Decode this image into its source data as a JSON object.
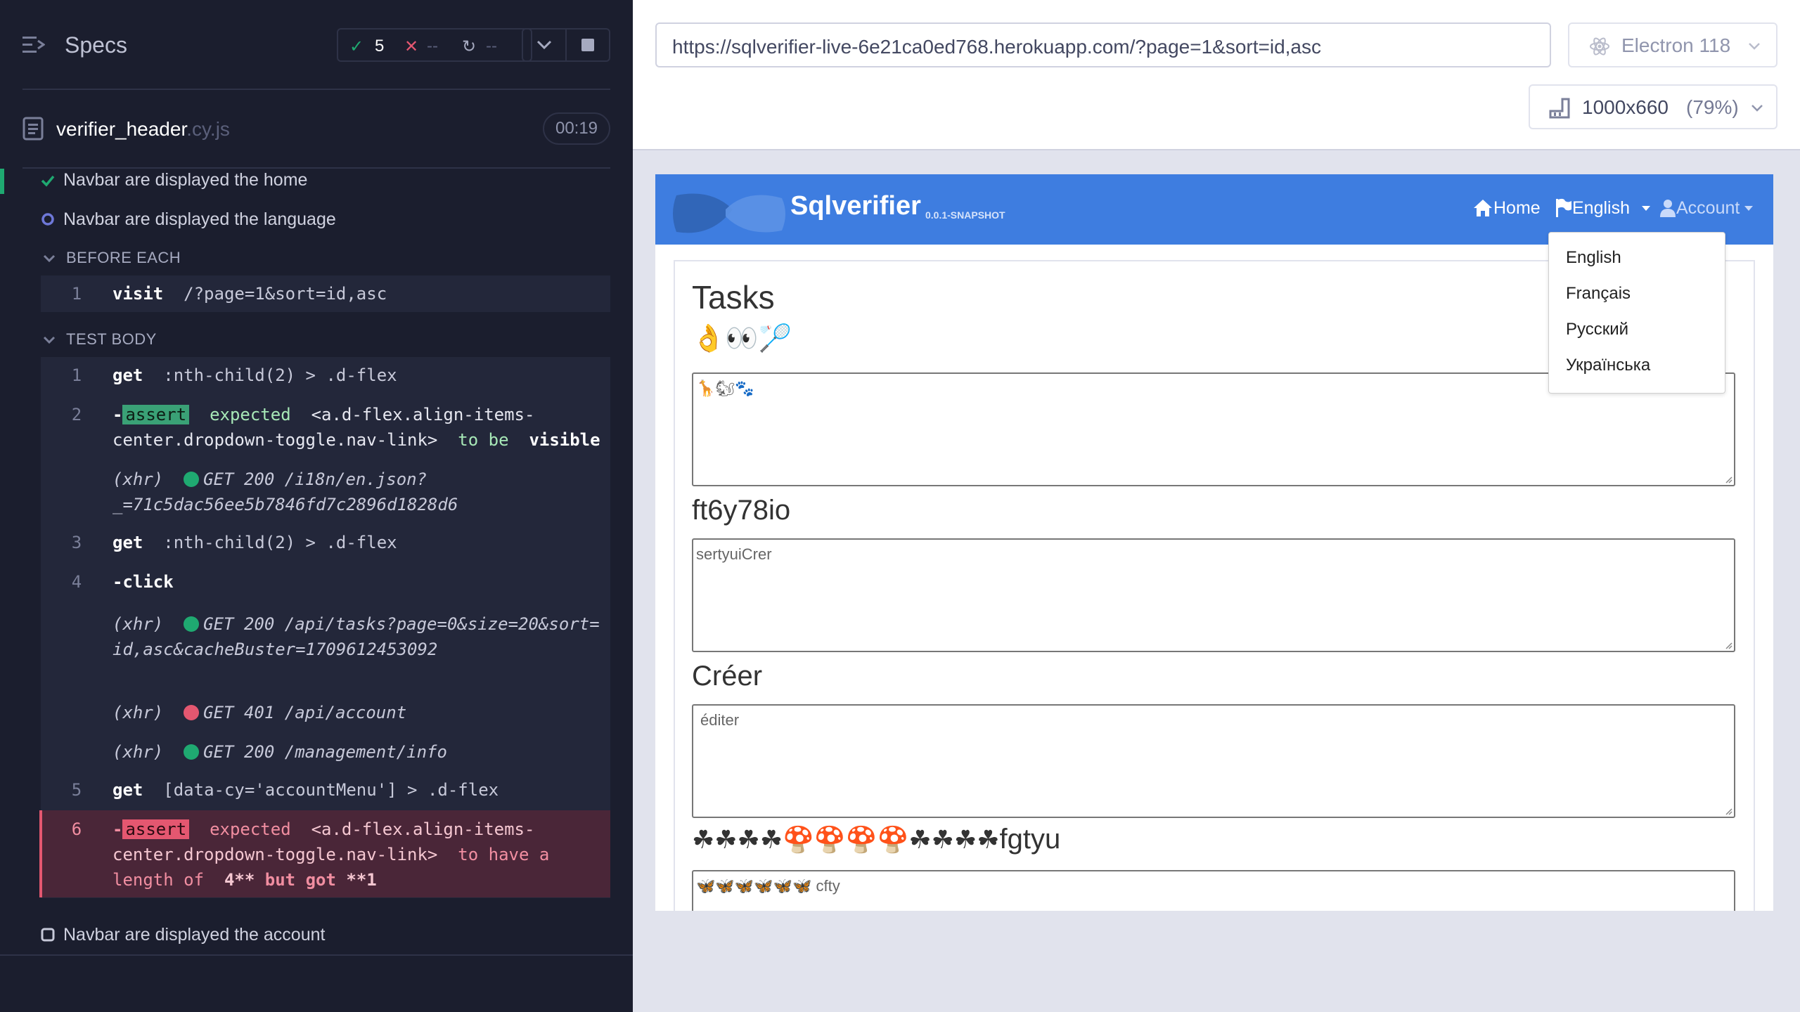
{
  "reporter": {
    "specs_label": "Specs",
    "passed_count": "5",
    "failed_count": "--",
    "pending_count": "--",
    "file_name": "verifier_header",
    "file_ext": ".cy.js",
    "duration": "00:19",
    "tests": {
      "home": "Navbar are displayed the home",
      "language": "Navbar are displayed the language",
      "account": "Navbar are displayed the account"
    },
    "sections": {
      "before_each": "BEFORE EACH",
      "test_body": "TEST BODY"
    },
    "before_each": {
      "num": "1",
      "cmd": "visit",
      "arg": "/?page=1&sort=id,asc"
    },
    "commands": {
      "c1": {
        "num": "1",
        "cmd": "get",
        "arg": ":nth-child(2) > .d-flex"
      },
      "c2": {
        "num": "2",
        "dash": "-",
        "badge": "assert",
        "w1": "expected",
        "sel": "<a.d-flex.align-items-center.dropdown-toggle.nav-link>",
        "w2": "to be",
        "w3": "visible"
      },
      "x1": {
        "label": "(xhr)",
        "req": "GET 200 /i18n/en.json?_=71c5dac56ee5b7846fd7c2896d1828d6"
      },
      "c3": {
        "num": "3",
        "cmd": "get",
        "arg": ":nth-child(2) > .d-flex"
      },
      "c4": {
        "num": "4",
        "cmd": "-click"
      },
      "x2": {
        "label": "(xhr)",
        "req": "GET 200 /api/tasks?page=0&size=20&sort=id,asc&cacheBuster=1709612453092"
      },
      "x3": {
        "label": "(xhr)",
        "req": "GET 401 /api/account"
      },
      "x4": {
        "label": "(xhr)",
        "req": "GET 200 /management/info"
      },
      "c5": {
        "num": "5",
        "cmd": "get",
        "arg": "[data-cy='accountMenu'] > .d-flex"
      },
      "c6": {
        "num": "6",
        "dash": "-",
        "badge": "assert",
        "w1": "expected",
        "sel": "<a.d-flex.align-items-center.dropdown-toggle.nav-link>",
        "w2": "to have a length of",
        "w3": "4**",
        "w4": "but got",
        "w5": "**1"
      }
    }
  },
  "topbar": {
    "url": "https://sqlverifier-live-6e21ca0ed768.herokuapp.com/?page=1&sort=id,asc",
    "browser": "Electron 118",
    "viewport": "1000x660",
    "scale": "(79%)"
  },
  "app": {
    "brand": "Sqlverifier",
    "version": "0.0.1-SNAPSHOT",
    "nav": {
      "home": "Home",
      "language": "English",
      "account": "Account"
    },
    "dropdown": [
      "English",
      "Français",
      "Русский",
      "Українська"
    ],
    "heading": "Tasks",
    "emoji_line": "👌👀🏸",
    "textarea1": "🦒🐿🐾",
    "title2": "ft6y78io",
    "textarea2": "sertyuiCrer",
    "title3": "Créer",
    "textarea3": "éditer",
    "title4_emoji": "☘☘☘☘🍄🍄🍄🍄☘☘☘☘",
    "title4_text": "fgtyu",
    "textarea4_emoji": "🦋🦋🦋🦋🦋🦋",
    "textarea4_text": " cfty"
  },
  "colors": {
    "passed": "#1fa971",
    "failed": "#e45770",
    "accent": "#3e7de0"
  }
}
